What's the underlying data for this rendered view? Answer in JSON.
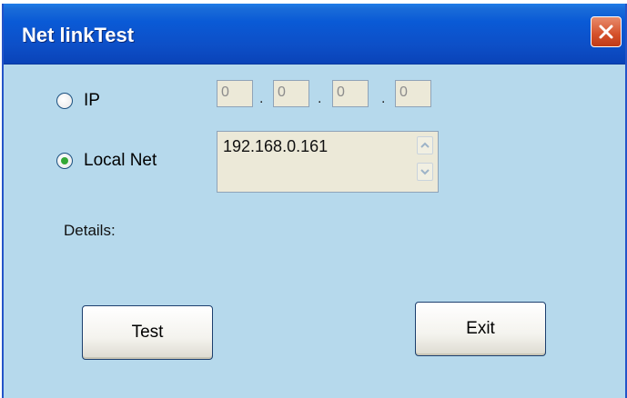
{
  "window": {
    "title": "Net linkTest"
  },
  "options": {
    "ip_label": "IP",
    "ip_selected": false,
    "ip_octets": [
      "0",
      "0",
      "0",
      "0"
    ],
    "local_label": "Local Net",
    "local_selected": true,
    "local_addresses": [
      "192.168.0.161"
    ]
  },
  "details": {
    "label": "Details:"
  },
  "buttons": {
    "test_label": "Test",
    "exit_label": "Exit"
  },
  "icons": {
    "close": "close-icon",
    "scroll_up": "chevron-up-icon",
    "scroll_down": "chevron-down-icon"
  },
  "colors": {
    "title_bar": "#0a5ad6",
    "window_bg": "#b6d9ec",
    "close_button": "#d4502a",
    "radio_dot": "#34a836"
  }
}
